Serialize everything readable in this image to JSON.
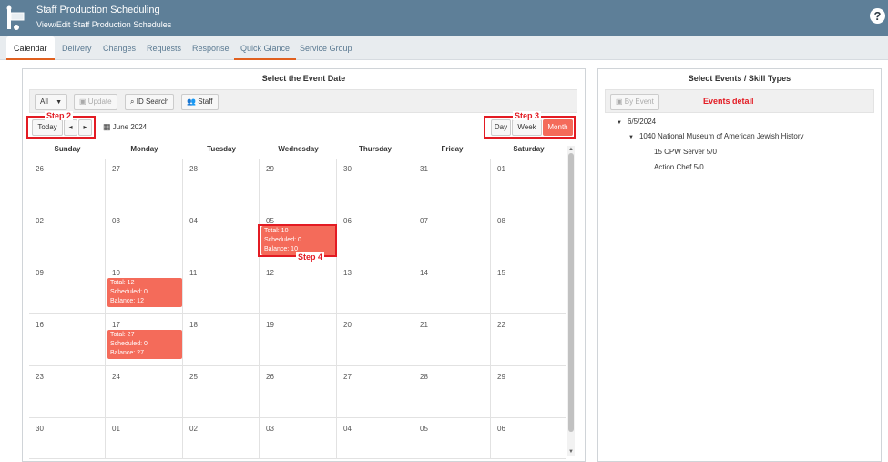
{
  "app": {
    "title": "Staff Production Scheduling",
    "subtitle": "View/Edit Staff Production Schedules",
    "help": "?"
  },
  "tabs": [
    "Calendar",
    "Delivery",
    "Changes",
    "Requests",
    "Response",
    "Quick Glance",
    "Service Group"
  ],
  "left_panel": {
    "title": "Select the Event Date",
    "toolbar": {
      "filter": "All",
      "filter_arrow": "▼",
      "update": "Update",
      "id_search": "ID Search",
      "staff": "Staff"
    },
    "nav": {
      "today": "Today",
      "prev": "◂",
      "next": "▸",
      "month_label": "June 2024",
      "views": [
        "Day",
        "Week",
        "Month"
      ],
      "selected_view": "Month"
    },
    "steps": {
      "step2": "Step 2",
      "step3": "Step 3",
      "step4": "Step 4"
    },
    "weekdays": [
      "Sunday",
      "Monday",
      "Tuesday",
      "Wednesday",
      "Thursday",
      "Friday",
      "Saturday"
    ],
    "weeks": [
      [
        "26",
        "27",
        "28",
        "29",
        "30",
        "31",
        "01"
      ],
      [
        "02",
        "03",
        "04",
        "05",
        "06",
        "07",
        "08"
      ],
      [
        "09",
        "10",
        "11",
        "12",
        "13",
        "14",
        "15"
      ],
      [
        "16",
        "17",
        "18",
        "19",
        "20",
        "21",
        "22"
      ],
      [
        "23",
        "24",
        "25",
        "26",
        "27",
        "28",
        "29"
      ],
      [
        "30",
        "01",
        "02",
        "03",
        "04",
        "05",
        "06"
      ]
    ],
    "events": {
      "jun5": [
        "Total: 10",
        "Scheduled: 0",
        "Balance: 10"
      ],
      "jun10": [
        "Total: 12",
        "Scheduled: 0",
        "Balance: 12"
      ],
      "jun17": [
        "Total: 27",
        "Scheduled: 0",
        "Balance: 27"
      ]
    }
  },
  "right_panel": {
    "title": "Select Events / Skill Types",
    "by_event": "By Event",
    "events_detail": "Events detail",
    "tree": {
      "date": "6/5/2024",
      "venue": "1040 National Museum of American Jewish History",
      "items": [
        "15 CPW Server 5/0",
        "Action Chef 5/0"
      ]
    }
  },
  "colors": {
    "header": "#5e7f98",
    "event": "#f46b5a",
    "annotation": "#e31b23",
    "tab_accent": "#e0601f"
  }
}
